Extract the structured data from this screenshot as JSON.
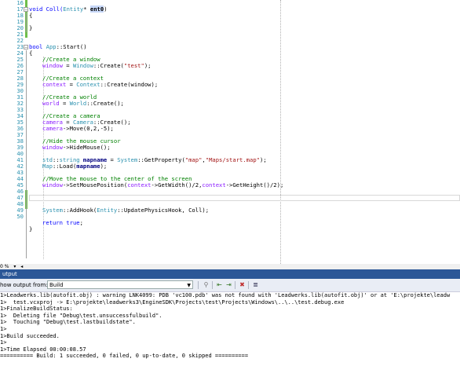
{
  "editor": {
    "line_numbers": [
      "16",
      "17",
      "18",
      "19",
      "20",
      "21",
      "22",
      "23",
      "24",
      "25",
      "26",
      "27",
      "28",
      "29",
      "30",
      "31",
      "32",
      "33",
      "34",
      "35",
      "36",
      "37",
      "38",
      "39",
      "40",
      "41",
      "42",
      "43",
      "44",
      "45",
      "46",
      "47",
      "48",
      "49",
      "50"
    ],
    "lines": {
      "l16": "",
      "l17": "void Coll(Entity* ent0)",
      "l17a": "void Coll(",
      "l17b": "Entity",
      "l17c": "* ",
      "l17d": "ent0",
      "l17e": ")",
      "l18": "{",
      "l20": "}",
      "l22a": "bool ",
      "l22b": "App",
      "l22c": "::Start()",
      "l23": "{",
      "l24": "//Create a window",
      "l25a": "window",
      "l25b": " = ",
      "l25c": "Window",
      "l25d": "::Create(",
      "l25e": "\"test\"",
      "l25f": ");",
      "l27": "//Create a context",
      "l28a": "context",
      "l28b": " = ",
      "l28c": "Context",
      "l28d": "::Create(window);",
      "l30": "//Create a world",
      "l31a": "world",
      "l31b": " = ",
      "l31c": "World",
      "l31d": "::Create();",
      "l33": "//Create a camera",
      "l34a": "camera",
      "l34b": " = ",
      "l34c": "Camera",
      "l34d": "::Create();",
      "l35a": "camera",
      "l35b": "->Move(0,2,-5);",
      "l37": "//Hide the mouse cursor",
      "l38a": "window",
      "l38b": "->HideMouse();",
      "l40a": "std",
      "l40b": "::",
      "l40c": "string",
      "l40d": " mapname",
      "l40e": " = ",
      "l40f": "System",
      "l40g": "::GetProperty(",
      "l40h": "\"map\"",
      "l40i": ",",
      "l40j": "\"Maps/start.map\"",
      "l40k": ");",
      "l41a": "Map",
      "l41b": "::Load(",
      "l41c": "mapname",
      "l41d": ");",
      "l43": "//Move the mouse to the center of the screen",
      "l44a": "window",
      "l44b": "->SetMousePosition(",
      "l44c": "context",
      "l44d": "->GetWidth()/2,",
      "l44e": "context",
      "l44f": "->GetHeight()/2);",
      "l46a": "System",
      "l46b": "::AddHook(",
      "l46c": "Entity",
      "l46d": "::UpdatePhysicsHook, Coll);",
      "l48a": "return ",
      "l48b": "true",
      "l48c": ";",
      "l49": "}"
    },
    "zoom_label": "0 %"
  },
  "output": {
    "title": "utput",
    "show_from_label": "how output from:",
    "show_from_value": "Build",
    "lines": [
      "1>Leadwerks.lib(autofit.obj) : warning LNK4099: PDB 'vc100.pdb' was not found with 'Leadwerks.lib(autofit.obj)' or at 'E:\\projekte\\leadw",
      "1>  test.vcxproj -> E:\\projekte\\leadwerks3\\EngineSDK\\Projects\\test\\Projects\\Windows\\..\\..\\test.debug.exe",
      "1>FinalizeBuildStatus:",
      "1>  Deleting file \"Debug\\test.unsuccessfulbuild\".",
      "1>  Touching \"Debug\\test.lastbuildstate\".",
      "1>",
      "1>Build succeeded.",
      "1>",
      "1>Time Elapsed 00:00:08.57",
      "========== Build: 1 succeeded, 0 failed, 0 up-to-date, 0 skipped =========="
    ]
  },
  "colors": {
    "output_title_bg": "#2b5797",
    "change_bar_green": "#6fbf4a",
    "change_bar_yellow": "#f0d000"
  }
}
